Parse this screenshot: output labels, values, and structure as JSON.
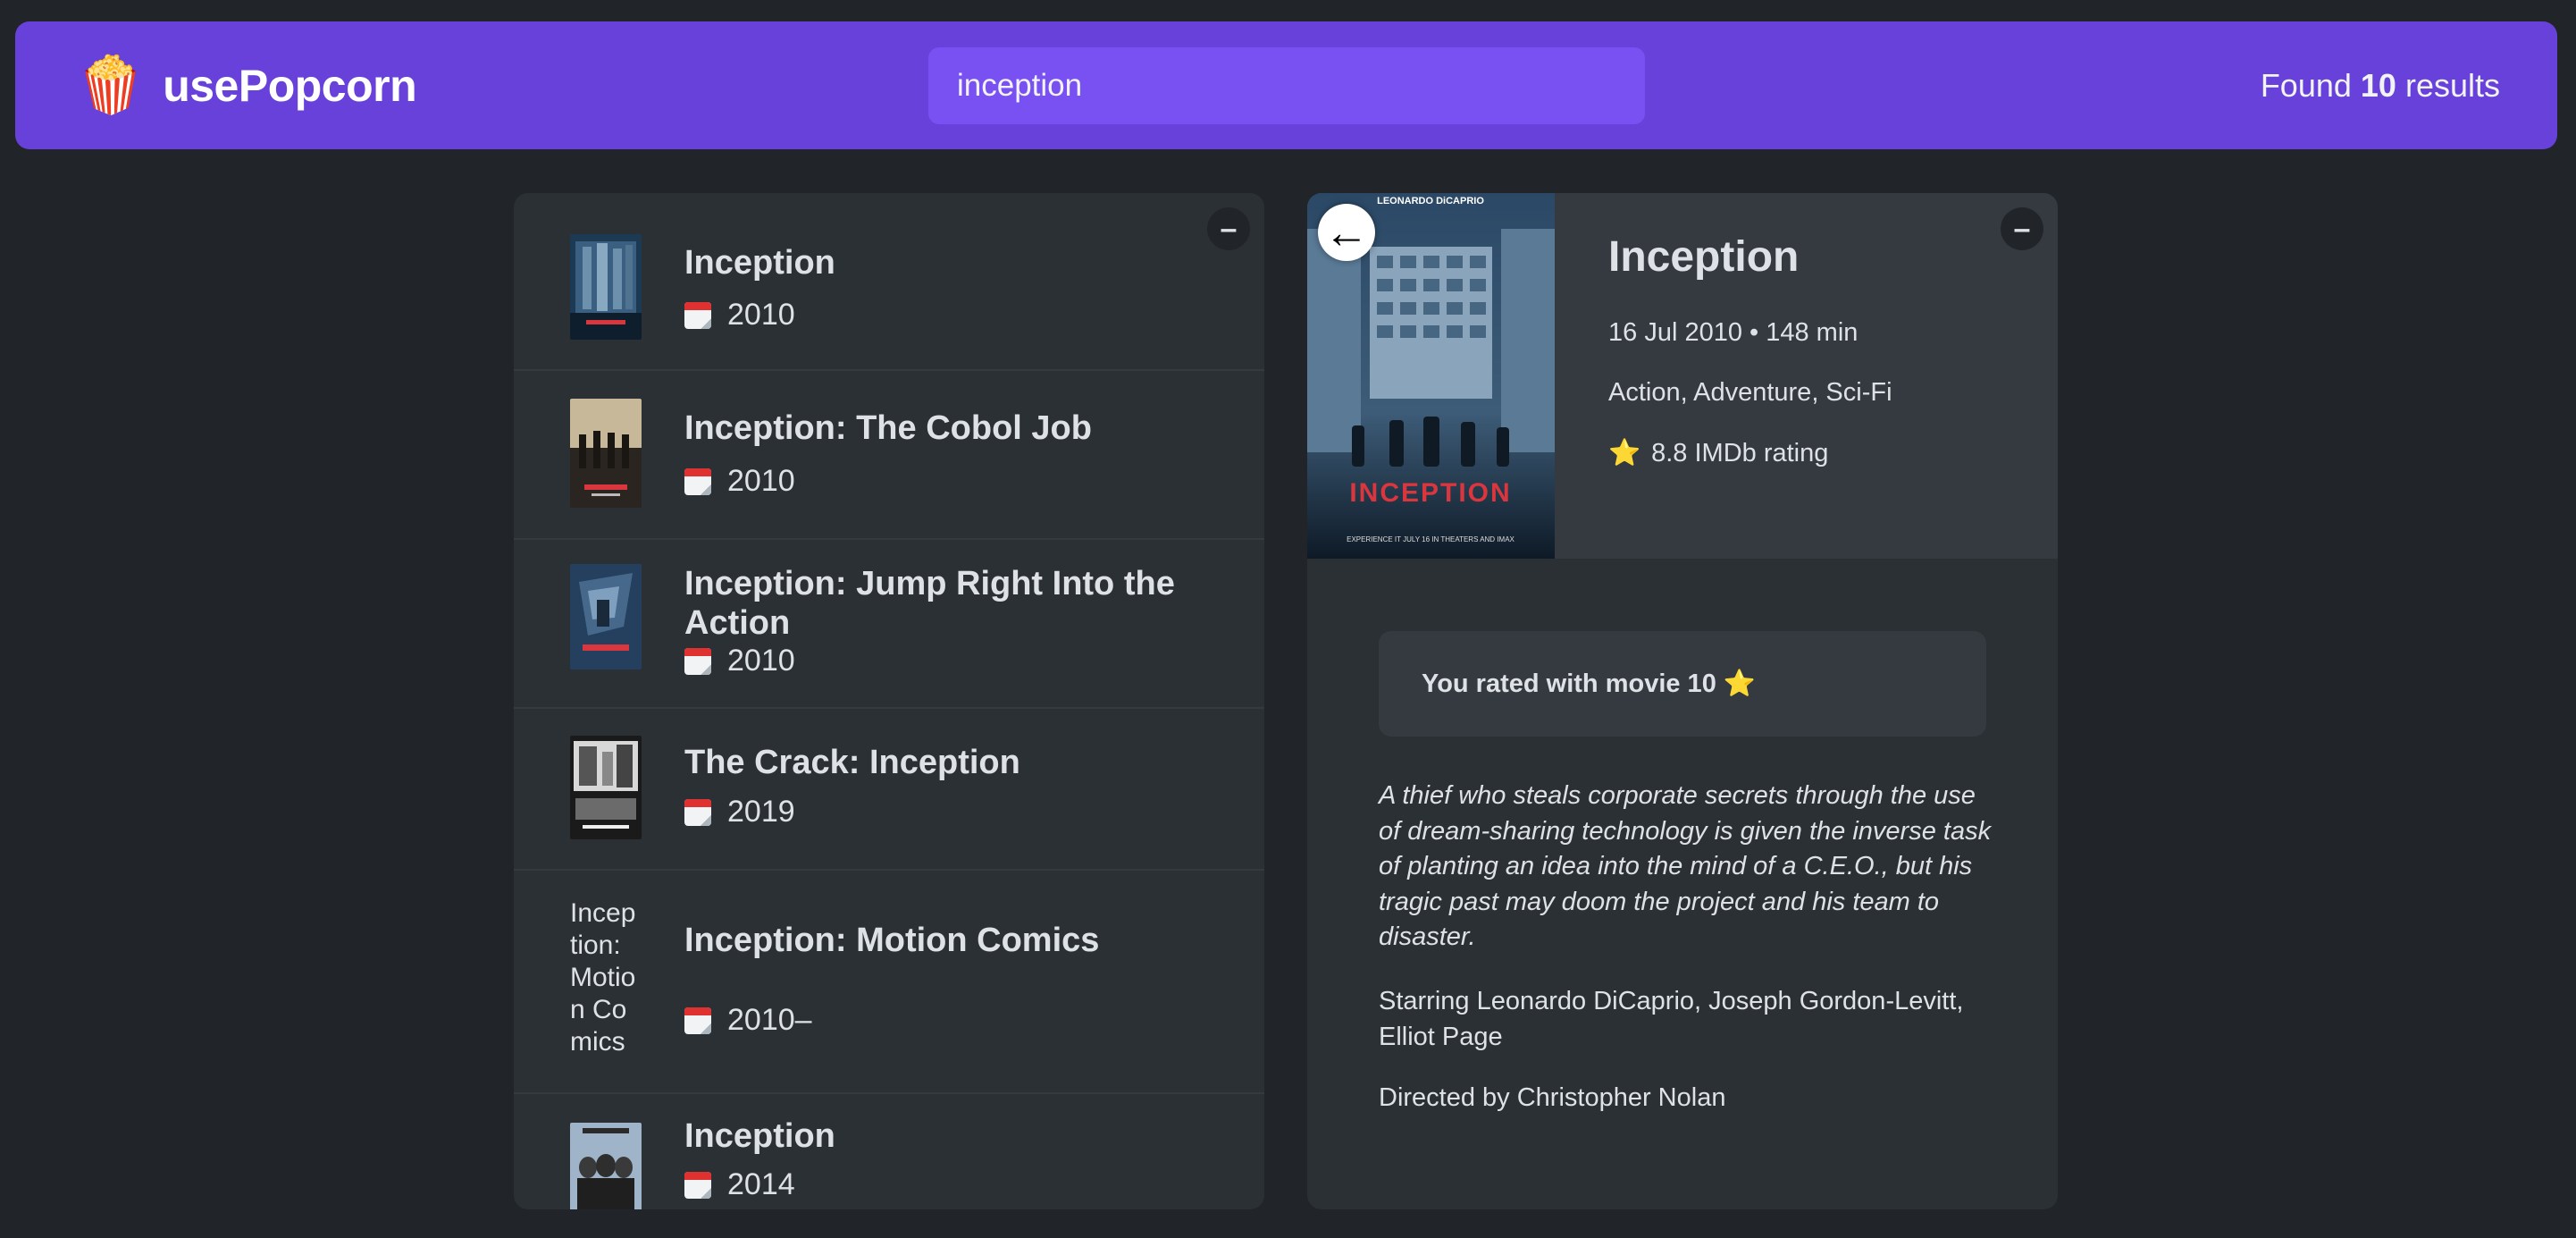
{
  "nav": {
    "logo_emoji": "🍿",
    "logo_text": "usePopcorn",
    "search_value": "inception",
    "results_prefix": "Found",
    "results_count": "10",
    "results_suffix": "results"
  },
  "list": {
    "toggle": "–",
    "movies": [
      {
        "title": "Inception",
        "year": "2010",
        "poster_alt": ""
      },
      {
        "title": "Inception: The Cobol Job",
        "year": "2010",
        "poster_alt": ""
      },
      {
        "title": "Inception: Jump Right Into the Action",
        "year": "2010",
        "poster_alt": ""
      },
      {
        "title": "The Crack: Inception",
        "year": "2019",
        "poster_alt": ""
      },
      {
        "title": "Inception: Motion Comics",
        "year": "2010–",
        "poster_alt": "Inception: Motion Comics poster"
      },
      {
        "title": "Inception",
        "year": "2014",
        "poster_alt": ""
      }
    ]
  },
  "details": {
    "toggle": "–",
    "back": "←",
    "title": "Inception",
    "released_runtime": "16 Jul 2010 • 148 min",
    "genre": "Action, Adventure, Sci-Fi",
    "rating_star": "⭐️",
    "imdb_rating": "8.8 IMDb rating",
    "user_rating": "You rated with movie 10 ⭐️",
    "plot": "A thief who steals corporate secrets through the use of dream-sharing technology is given the inverse task of planting an idea into the mind of a C.E.O., but his tragic past may doom the project and his team to disaster.",
    "starring": "Starring Leonardo DiCaprio, Joseph Gordon-Levitt, Elliot Page",
    "director": "Directed by Christopher Nolan",
    "poster_text_top": "LEONARDO DiCAPRIO",
    "poster_text_title": "INCEPTION",
    "poster_text_bottom": "EXPERIENCE IT JULY 16 IN THEATERS AND IMAX"
  }
}
